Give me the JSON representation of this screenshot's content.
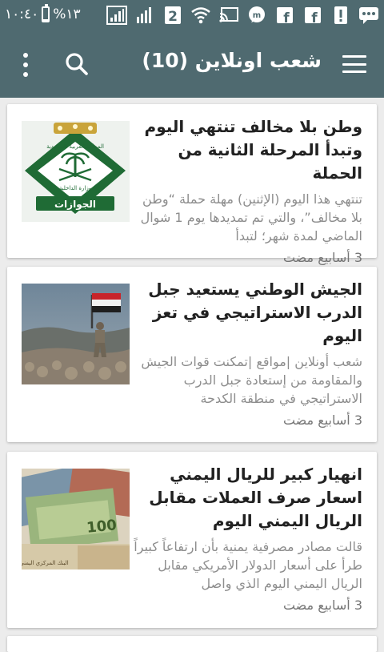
{
  "status_bar": {
    "time": "١٠:٤٠",
    "battery_percent": "%١٣",
    "battery_level": 0.13,
    "notification_icons": [
      "signal-bars-icon",
      "signal-bars-icon",
      "sim-2-icon",
      "wifi-icon",
      "cast-icon",
      "messenger-icon",
      "facebook-icon",
      "facebook-icon",
      "alert-icon",
      "chat-bubble-icon"
    ],
    "colors": {
      "bar_bg": "#4f6a70"
    }
  },
  "app_bar": {
    "title": "شعب اونلاين (10)",
    "icons": {
      "menu": "menu-icon",
      "search": "search-icon",
      "overflow": "overflow-menu-icon"
    }
  },
  "articles": [
    {
      "headline": "وطن بلا مخالف تنتهي اليوم وتبدأ المرحلة الثانية من الحملة",
      "summary": "تنتهي هذا اليوم (الإثنين) مهلة حملة “وطن بلا مخالف”، والتي تم تمديدها يوم 1 شوال الماضي لمدة شهر؛ لتبدأ",
      "time": "3 أسابيع مضت",
      "image_text": [
        "المملكة العربية السعودية",
        "وزارة الداخلية",
        "الجوازات"
      ]
    },
    {
      "headline": "الجيش الوطني يستعيد جبل الدرب الاستراتيجي في تعز اليوم",
      "summary": "شعب أونلاين |مواقع |تمكنت قوات الجيش والمقاومة من إستعادة جبل الدرب الاستراتيجي في منطقة الكدحة",
      "time": "3 أسابيع مضت"
    },
    {
      "headline": "انهيار كبير للريال اليمني اسعار صرف العملات مقابل الريال اليمني اليوم",
      "summary": "قالت مصادر مصرفية يمنية بأن ارتفاعاً كبيراً طرأ على أسعار الدولار الأمريكي مقابل الريال اليمني اليوم الذي واصل",
      "time": "3 أسابيع مضت",
      "image_text": [
        "100",
        "البنك المركزي اليمني"
      ]
    }
  ]
}
